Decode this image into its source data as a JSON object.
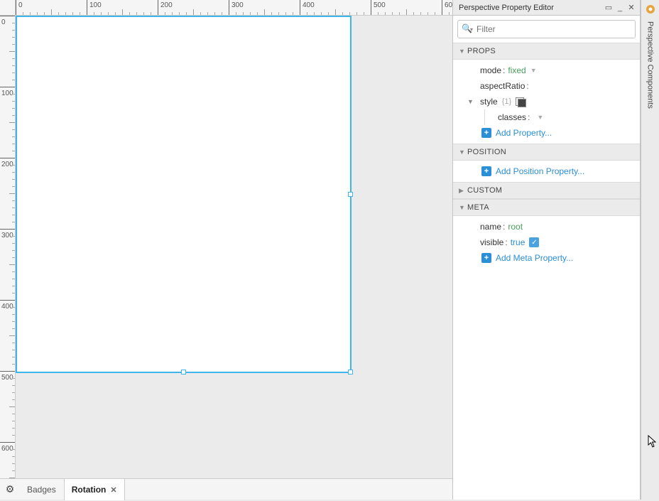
{
  "ruler": {
    "majors_h": [
      0,
      100,
      200,
      300,
      400,
      500,
      600
    ],
    "majors_v": [
      0,
      100,
      200,
      300,
      400,
      500,
      600
    ]
  },
  "tabs": {
    "items": [
      {
        "label": "Badges",
        "active": false
      },
      {
        "label": "Rotation",
        "active": true
      }
    ]
  },
  "editor": {
    "title": "Perspective Property Editor",
    "filter_placeholder": "Filter",
    "sections": {
      "props": {
        "label": "PROPS",
        "mode_key": "mode",
        "mode_val": "fixed",
        "aspect_key": "aspectRatio",
        "style_key": "style",
        "style_count": "{1}",
        "classes_key": "classes",
        "add_label": "Add Property..."
      },
      "position": {
        "label": "POSITION",
        "add_label": "Add Position Property..."
      },
      "custom": {
        "label": "CUSTOM"
      },
      "meta": {
        "label": "META",
        "name_key": "name",
        "name_val": "root",
        "visible_key": "visible",
        "visible_val": "true",
        "add_label": "Add Meta Property..."
      }
    }
  },
  "dock": {
    "tab_label": "Perspective Components"
  }
}
